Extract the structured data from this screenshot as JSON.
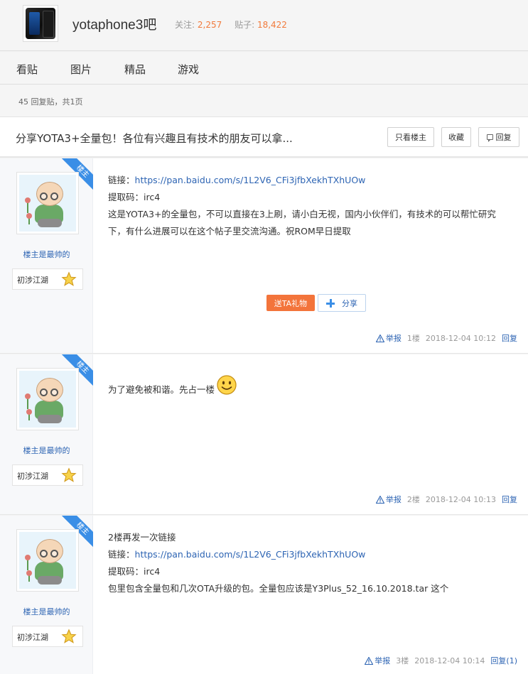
{
  "forum": {
    "name": "yotaphone3吧",
    "follow_label": "关注:",
    "follow_count": "2,257",
    "posts_label": "贴子:",
    "posts_count": "18,422"
  },
  "nav": {
    "tabs": [
      "看贴",
      "图片",
      "精品",
      "游戏"
    ]
  },
  "reply_bar": {
    "text": "45 回复贴，共1页"
  },
  "thread": {
    "title": "分享YOTA3+全量包！各位有兴趣且有技术的朋友可以拿...",
    "only_op_label": "只看楼主",
    "fav_label": "收藏",
    "reply_label": "回复"
  },
  "posts": [
    {
      "ribbon": "楼主",
      "username": "楼主是最帅的",
      "level": "初涉江湖",
      "lines": {
        "link_label": "链接：",
        "link_url": "https://pan.baidu.com/s/1L2V6_CFi3jfbXekhTXhUOw",
        "code": "提取码：irc4",
        "body": "这是YOTA3+的全量包，不可以直接在3上刷，请小白无视，国内小伙伴们，有技术的可以帮忙研究下，有什么进展可以在这个帖子里交流沟通。祝ROM早日提取"
      },
      "gift_label": "送TA礼物",
      "share_label": "分享",
      "report": "举报",
      "floor": "1楼",
      "time": "2018-12-04 10:12",
      "reply": "回复"
    },
    {
      "ribbon": "楼主",
      "username": "楼主是最帅的",
      "level": "初涉江湖",
      "text": "为了避免被和谐。先占一楼",
      "report": "举报",
      "floor": "2楼",
      "time": "2018-12-04 10:13",
      "reply": "回复"
    },
    {
      "ribbon": "楼主",
      "username": "楼主是最帅的",
      "level": "初涉江湖",
      "lines": {
        "intro": "2楼再发一次链接",
        "link_label": "链接：",
        "link_url": "https://pan.baidu.com/s/1L2V6_CFi3jfbXekhTXhUOw",
        "code": "提取码：irc4",
        "body": "包里包含全量包和几次OTA升级的包。全量包应该是Y3Plus_52_16.10.2018.tar 这个"
      },
      "report": "举报",
      "floor": "3楼",
      "time": "2018-12-04 10:14",
      "reply": "回复(1)"
    }
  ],
  "colors": {
    "accent_blue": "#2d64b3",
    "ribbon_blue": "#3a8ee6",
    "stat_orange": "#f17a3b",
    "gift_orange": "#f3743b"
  },
  "icons": [
    "phone-logo-icon",
    "reply-icon",
    "star-icon",
    "warning-icon",
    "plus-icon",
    "smiley-icon"
  ]
}
